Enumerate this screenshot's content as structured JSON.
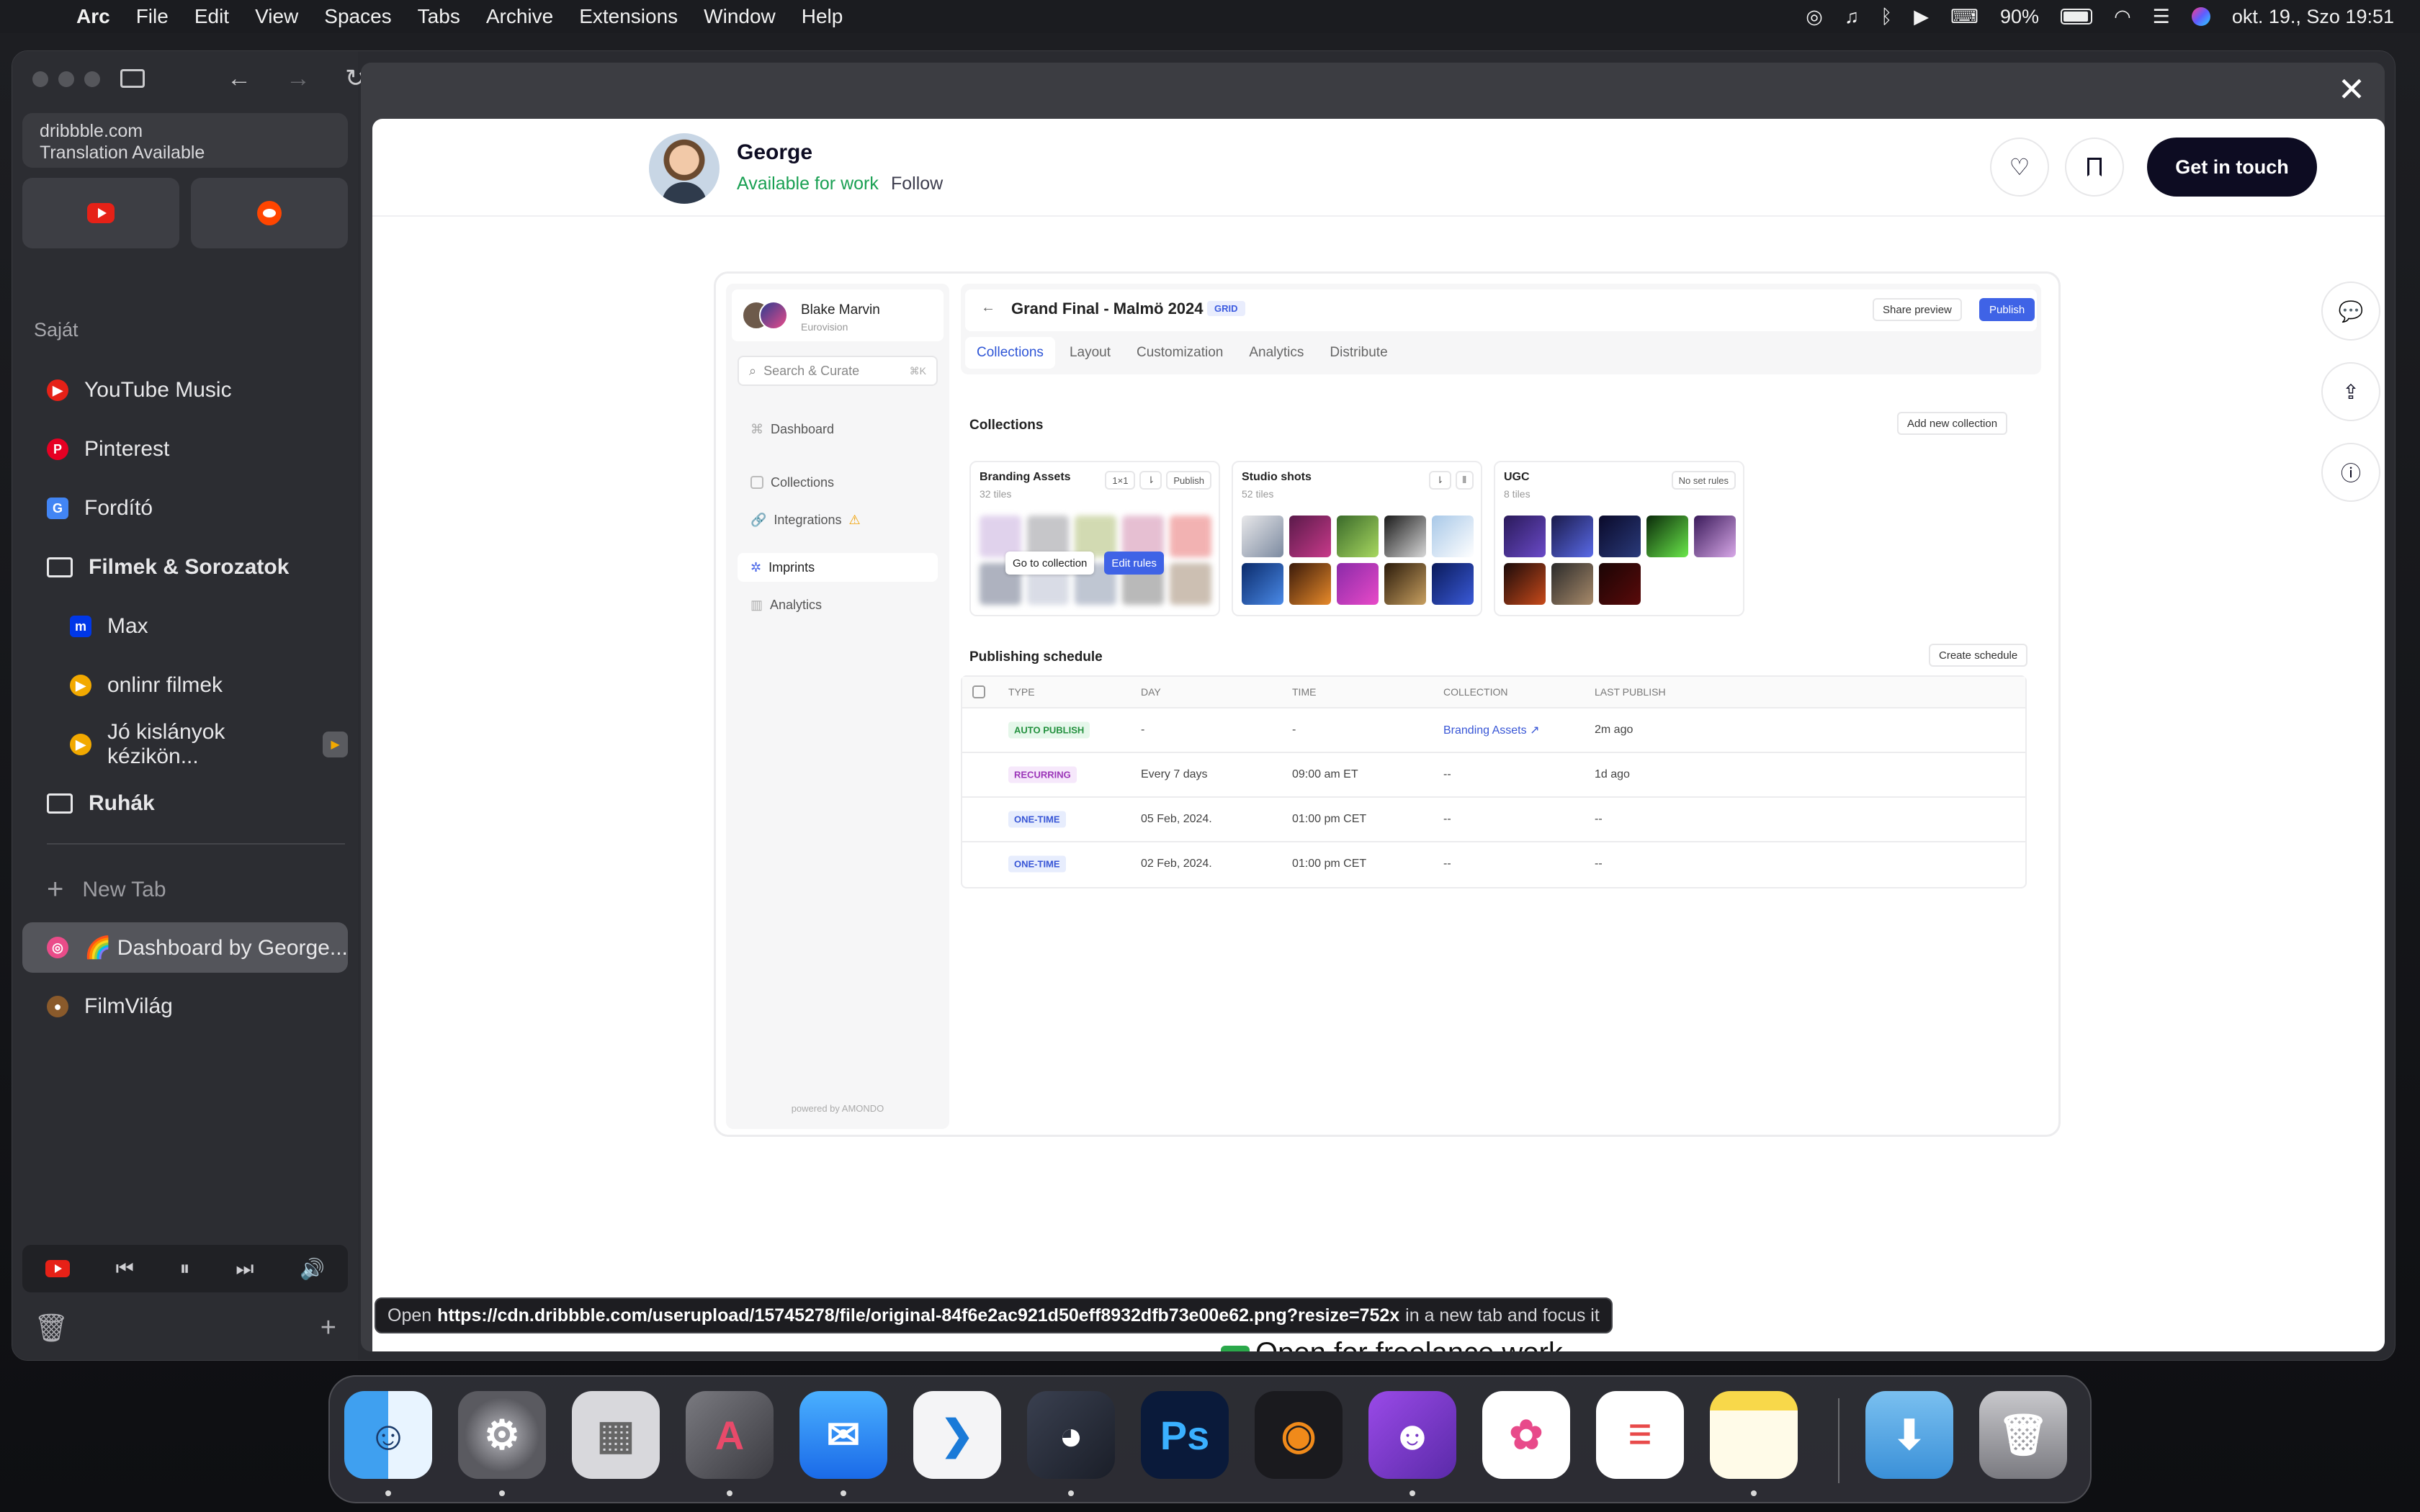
{
  "menubar": {
    "app": "Arc",
    "items": [
      "File",
      "Edit",
      "View",
      "Spaces",
      "Tabs",
      "Archive",
      "Extensions",
      "Window",
      "Help"
    ],
    "battery": "90%",
    "datetime": "okt. 19., Szo  19:51"
  },
  "sidebar": {
    "url_domain": "dribbble.com",
    "url_note": "Translation Available",
    "section": "Saját",
    "items": [
      {
        "label": "YouTube Music",
        "color": "#e62117"
      },
      {
        "label": "Pinterest",
        "color": "#e60023"
      },
      {
        "label": "Fordító",
        "color": "#4285f4"
      },
      {
        "label": "Filmek & Sorozatok"
      },
      {
        "label": "Max",
        "color": "#0037e8"
      },
      {
        "label": "onlinr filmek",
        "color": "#f2a900"
      },
      {
        "label": "Jó kislányok kézikön...",
        "color": "#f2a900"
      },
      {
        "label": "Ruhák"
      }
    ],
    "new_tab": "New Tab",
    "active_tab": "🌈 Dashboard by George...",
    "last_tab": "FilmVilág"
  },
  "shot_header": {
    "name": "George",
    "availability": "Available for work",
    "follow": "Follow",
    "cta": "Get in touch"
  },
  "dashboard": {
    "user_name": "Blake Marvin",
    "user_sub": "Eurovision",
    "search_placeholder": "Search & Curate",
    "search_kbd": "⌘K",
    "nav": [
      "Dashboard",
      "Collections",
      "Integrations",
      "Imprints",
      "Analytics"
    ],
    "powered": "powered by AMONDO",
    "title": "Grand Final - Malmö 2024",
    "grid_badge": "GRID",
    "share": "Share preview",
    "publish": "Publish",
    "tabs": [
      "Collections",
      "Layout",
      "Customization",
      "Analytics",
      "Distribute"
    ],
    "collections_heading": "Collections",
    "add_collection": "Add new collection",
    "cards": [
      {
        "title": "Branding Assets",
        "sub": "32 tiles",
        "chips": [
          "1×1",
          "⇂",
          "Publish"
        ]
      },
      {
        "title": "Studio shots",
        "sub": "52 tiles",
        "chips": [
          "⇂",
          "⫴"
        ]
      },
      {
        "title": "UGC",
        "sub": "8 tiles",
        "chips": [
          "No set rules"
        ]
      }
    ],
    "go_to_collection": "Go to collection",
    "edit_rules": "Edit rules",
    "schedule_heading": "Publishing schedule",
    "create_schedule": "Create schedule",
    "columns": [
      "TYPE",
      "DAY",
      "TIME",
      "COLLECTION",
      "LAST PUBLISH"
    ],
    "rows": [
      {
        "type": "AUTO PUBLISH",
        "day": "-",
        "time": "-",
        "collection": "Branding Assets ↗",
        "last": "2m ago"
      },
      {
        "type": "RECURRING",
        "day": "Every 7 days",
        "time": "09:00 am ET",
        "collection": "--",
        "last": "1d ago"
      },
      {
        "type": "ONE-TIME",
        "day": "05 Feb, 2024.",
        "time": "01:00 pm CET",
        "collection": "--",
        "last": "--"
      },
      {
        "type": "ONE-TIME",
        "day": "02 Feb, 2024.",
        "time": "01:00 pm CET",
        "collection": "--",
        "last": "--"
      }
    ]
  },
  "freelance": "Open for freelance work",
  "status": {
    "prefix": "Open",
    "url": "https://cdn.dribbble.com/userupload/15745278/file/original-84f6e2ac921d50eff8932dfb73e00e62.png?resize=752x",
    "suffix": "in a new tab and focus it"
  },
  "dock": [
    "finder-icon",
    "system-settings-icon",
    "launchpad-icon",
    "affinity-icon",
    "mail-icon",
    "vscode-icon",
    "davinci-icon",
    "photoshop-icon",
    "blender-icon",
    "github-icon",
    "photos-icon",
    "reminders-icon",
    "notes-icon",
    "downloads-icon",
    "trash-icon"
  ]
}
